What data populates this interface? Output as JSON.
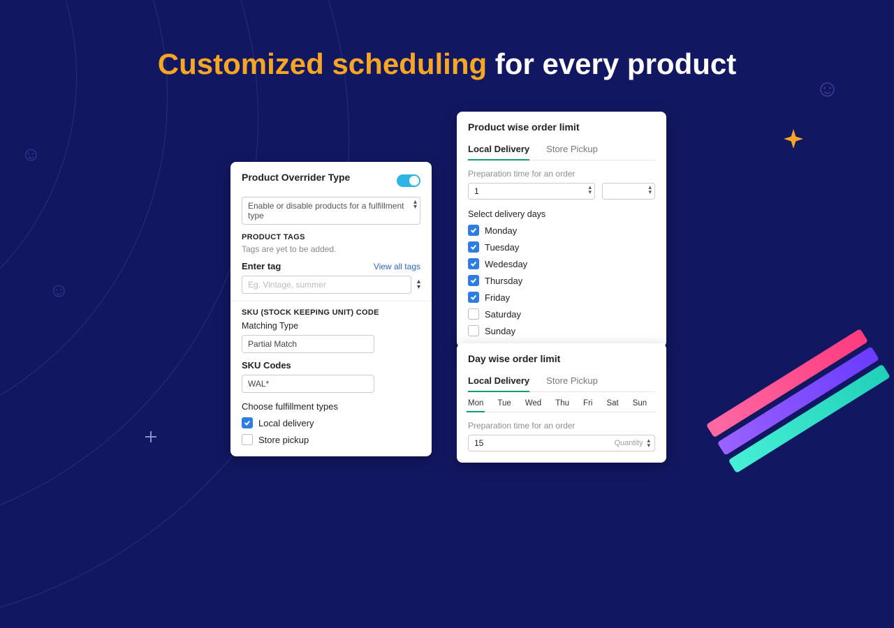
{
  "headline": {
    "accent": "Customized scheduling",
    "rest": " for every product"
  },
  "card1": {
    "title": "Product Overrider Type",
    "toggle_on": true,
    "type_select": "Enable or disable products for a fulfillment type",
    "tags_heading": "PRODUCT TAGS",
    "tags_hint": "Tags are yet to be added.",
    "enter_tag_label": "Enter tag",
    "view_all_tags": "View all tags",
    "tag_placeholder": "Eg. Vintage, summer",
    "sku_heading": "SKU (STOCK KEEPING UNIT) CODE",
    "matching_type_label": "Matching Type",
    "matching_type_value": "Partial Match",
    "sku_codes_label": "SKU Codes",
    "sku_codes_value": "WAL*",
    "fulfillment_label": "Choose fulfillment types",
    "fulfillment_options": [
      {
        "label": "Local delivery",
        "checked": true
      },
      {
        "label": "Store pickup",
        "checked": false
      }
    ]
  },
  "card2": {
    "title": "Product wise order limit",
    "tabs": [
      {
        "label": "Local Delivery",
        "active": true
      },
      {
        "label": "Store Pickup",
        "active": false
      }
    ],
    "prep_label": "Preparation time for an order",
    "prep_value": "1",
    "prep_unit": "",
    "days_label": "Select delivery days",
    "days": [
      {
        "label": "Monday",
        "checked": true
      },
      {
        "label": "Tuesday",
        "checked": true
      },
      {
        "label": "Wedesday",
        "checked": true
      },
      {
        "label": "Thursday",
        "checked": true
      },
      {
        "label": "Friday",
        "checked": true
      },
      {
        "label": "Saturday",
        "checked": false
      },
      {
        "label": "Sunday",
        "checked": false
      }
    ]
  },
  "card3": {
    "title": "Day wise order limit",
    "tabs": [
      {
        "label": "Local Delivery",
        "active": true
      },
      {
        "label": "Store Pickup",
        "active": false
      }
    ],
    "day_tabs": [
      "Mon",
      "Tue",
      "Wed",
      "Thu",
      "Fri",
      "Sat",
      "Sun"
    ],
    "active_day": "Mon",
    "prep_label": "Preparation time for an order",
    "prep_value": "15",
    "qty_label": "Quantity"
  }
}
